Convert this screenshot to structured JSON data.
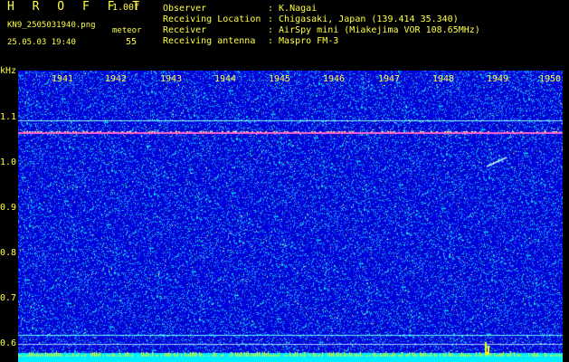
{
  "header": {
    "logo": "H R O F F T",
    "version": "1.00f",
    "file_name": "KN9_2505031940.png",
    "meteor_label": "meteor",
    "datetime": "25.05.03 19:40",
    "count": "55"
  },
  "info": [
    {
      "key": "Observer",
      "value": ": K.Nagai"
    },
    {
      "key": "Receiving Location",
      "value": ": Chigasaki, Japan (139.414 35.340)"
    },
    {
      "key": "Receiver",
      "value": ": AirSpy mini (Miakejima VOR 108.65MHz)"
    },
    {
      "key": "Receiving antenna",
      "value": ": Maspro FM-3"
    }
  ],
  "axes": {
    "y_unit": "kHz",
    "y_ticks": [
      "1.1",
      "1.0",
      "0.9",
      "0.8",
      "0.7",
      "0.6"
    ],
    "x_ticks": [
      "1941",
      "1942",
      "1943",
      "1944",
      "1945",
      "1946",
      "1947",
      "1948",
      "1949",
      "1950"
    ]
  },
  "colors": {
    "background": "#000000",
    "plot_background": "#0000d8",
    "text": "#ffff44",
    "carrier_line": "#ff66cc",
    "noise_cyan": "#00ffff"
  }
}
